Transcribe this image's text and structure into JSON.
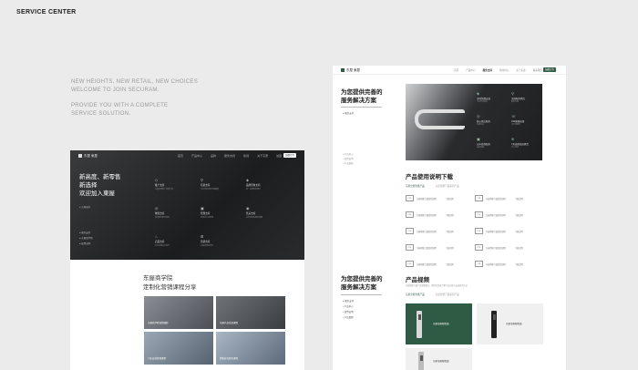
{
  "header": {
    "title": "SERVICE CENTER"
  },
  "tagline": {
    "line1": "NEW HEIGHTS, NEW RETAIL, NEW CHOICES",
    "line2": "WELCOME TO JOIN SECURAM.",
    "line3": "PROVIDE YOU WITH A COMPLETE",
    "line4": "SERVICE SOLUTION."
  },
  "left_mockup": {
    "logo": "东屋 東屋",
    "nav": [
      "首页",
      "产品中心",
      "品牌",
      "服务支持",
      "新闻",
      "关于东屋",
      "加盟"
    ],
    "nav_button": "加盟合作",
    "heading_line1": "新高度、新零售",
    "heading_line2": "新选择",
    "heading_line3": "欢迎加入東屋",
    "small_text": "● 东屋服务",
    "services": [
      {
        "icon": "◇",
        "title": "推广支持",
        "desc": "东屋优质推广资源支持"
      },
      {
        "icon": "⚲",
        "title": "培训支持",
        "desc": "专业培训体系全面赋能"
      },
      {
        "icon": "◈",
        "title": "品牌形象支持",
        "desc": "统一品牌形象展示"
      },
      {
        "icon": "◎",
        "title": "物流支持",
        "desc": "高效物流配送体系"
      },
      {
        "icon": "▣",
        "title": "管理支持",
        "desc": "系统化门店管理"
      },
      {
        "icon": "◉",
        "title": "售后支持",
        "desc": "完善的售后服务保障"
      },
      {
        "icon": "⌂",
        "title": "店面支持",
        "desc": "专业店面设计指导"
      },
      {
        "icon": "⊞",
        "title": "营销支持",
        "desc": "多渠道营销活动"
      }
    ],
    "side_list": [
      "● 服务支持",
      "● 东屋商学院",
      "● 使用说明"
    ],
    "academy_title": "东屋商学院",
    "academy_subtitle": "定制化营销课程分享",
    "course_cards": [
      "东屋商学院营销课程",
      "东屋产品培训课程",
      "门店运营管理课程",
      "销售技巧提升课程"
    ]
  },
  "right_mockup": {
    "logo": "东屋 東屋",
    "nav": [
      "首页",
      "产品中心",
      "服务支持",
      "新闻中心",
      "关于东屋",
      "联系我们"
    ],
    "active_nav": "服务支持",
    "nav_button": "加盟合作",
    "section1_title_line1": "为您提供完善的",
    "section1_title_line2": "服务解决方案",
    "section1_small": "● 服务支持",
    "section1_dots": [
      "• 产品中心",
      "• 使用说明",
      "• 产品视频"
    ],
    "hero_services": [
      {
        "icon": "◈",
        "title": "全国免费安装",
        "desc": "专业安装团队"
      },
      {
        "icon": "⚲",
        "title": "全国服务网点",
        "desc": "覆盖全国"
      },
      {
        "icon": "◎",
        "title": "贴心售后服务",
        "desc": "快速响应"
      },
      {
        "icon": "☏",
        "title": "24h客服热线",
        "desc": "全天候服务"
      },
      {
        "icon": "▣",
        "title": "五年质保服务",
        "desc": "品质保障"
      },
      {
        "icon": "⊕",
        "title": "7天无理由退换货",
        "desc": "安心购物"
      }
    ],
    "download_title": "产品使用说明下载",
    "download_tabs": [
      "东屋全屋智能产品",
      "东屋智能门锁系列产品"
    ],
    "downloads": [
      {
        "type": "PDF",
        "name": "东屋智能门锁使用说明",
        "action": "下载说明"
      },
      {
        "type": "PDF",
        "name": "东屋智能门锁使用说明",
        "action": "下载说明"
      },
      {
        "type": "PDF",
        "name": "东屋智能门锁使用说明",
        "action": "下载说明"
      },
      {
        "type": "PDF",
        "name": "东屋智能门锁使用说明",
        "action": "下载说明"
      },
      {
        "type": "PDF",
        "name": "东屋智能门锁使用说明",
        "action": "下载说明"
      },
      {
        "type": "PDF",
        "name": "东屋智能门锁使用说明",
        "action": "下载说明"
      },
      {
        "type": "PDF",
        "name": "东屋智能门锁使用说明",
        "action": "下载说明"
      },
      {
        "type": "PDF",
        "name": "东屋智能门锁使用说明",
        "action": "下载说明"
      },
      {
        "type": "PDF",
        "name": "东屋智能门锁使用说明",
        "action": "下载说明"
      },
      {
        "type": "PDF",
        "name": "东屋智能门锁使用说明",
        "action": "下载说明"
      }
    ],
    "section2_title_line1": "为您提供完善的",
    "section2_title_line2": "服务解决方案",
    "section2_list": [
      "● 服务支持",
      "• 产品中心",
      "• 使用说明",
      "• 产品视频"
    ],
    "video_title": "产品视频",
    "video_subtitle": "东屋智能门锁产品视频展示，帮助您快速了解产品功能与安装使用方法",
    "video_tabs": [
      "东屋全屋智能产品",
      "东屋智能门锁系列产品"
    ],
    "video_cards": [
      "东屋全屋智能锁",
      "东屋全屋智能锁",
      "东屋全屋智能锁"
    ]
  }
}
